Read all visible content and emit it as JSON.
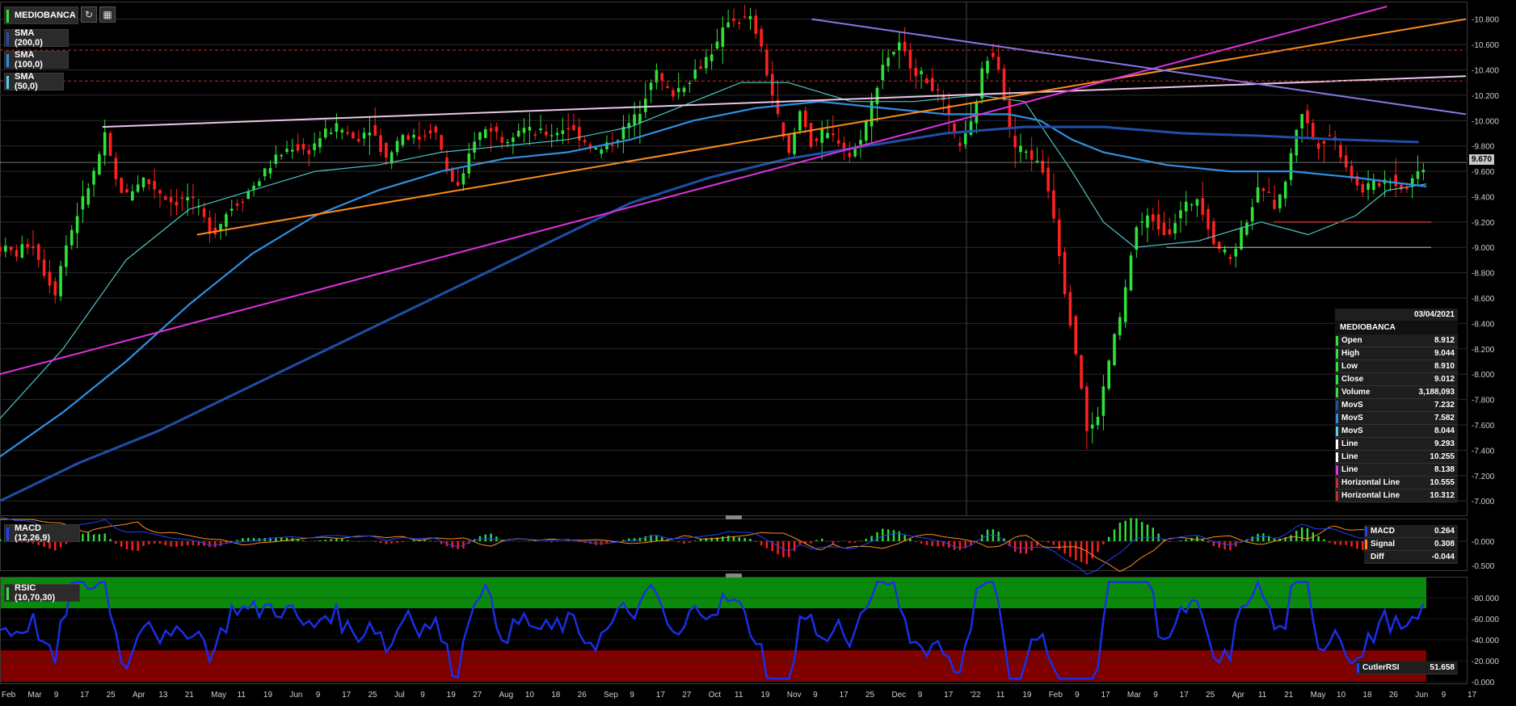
{
  "toolbar": {
    "symbol": "MEDIOBANCA",
    "refresh_icon": "refresh-icon",
    "calendar_icon": "calendar-icon"
  },
  "indicators": [
    {
      "label": "SMA (200,0)",
      "color": "#1f4fa8"
    },
    {
      "label": "SMA (100,0)",
      "color": "#2f8fe0"
    },
    {
      "label": "SMA (50,0)",
      "color": "#56d0e8"
    }
  ],
  "last_price": "9.670",
  "colors": {
    "bg": "#000000",
    "grid": "#2a2a2a",
    "up": "#2ee23a",
    "down": "#ff2020",
    "sma200": "#1f4fa8",
    "sma100": "#2f8fe0",
    "sma50": "#4cc6c6",
    "line_white": "#e8c8e8",
    "line_orange": "#ff8c1a",
    "line_magenta": "#e030e0",
    "line_lavender": "#8878e8",
    "hline": "#c03030",
    "macd": "#2040ff",
    "signal": "#ff8c1a",
    "rsi": "#1a2ee8",
    "rsi_high": "#0a8a0a",
    "rsi_low": "#800000"
  },
  "info_panel": {
    "date": "03/04/2021",
    "name": "MEDIOBANCA",
    "rows": [
      {
        "label": "Open",
        "value": "8.912",
        "color": "#2ee23a"
      },
      {
        "label": "High",
        "value": "9.044",
        "color": "#2ee23a"
      },
      {
        "label": "Low",
        "value": "8.910",
        "color": "#2ee23a"
      },
      {
        "label": "Close",
        "value": "9.012",
        "color": "#2ee23a"
      },
      {
        "label": "Volume",
        "value": "3,188,093",
        "color": "#2ee23a"
      },
      {
        "label": "MovS",
        "value": "7.232",
        "color": "#1f4fa8"
      },
      {
        "label": "MovS",
        "value": "7.582",
        "color": "#2f8fe0"
      },
      {
        "label": "MovS",
        "value": "8.044",
        "color": "#56d0e8"
      },
      {
        "label": "Line",
        "value": "9.293",
        "color": "#ffffff"
      },
      {
        "label": "Line",
        "value": "10.255",
        "color": "#ffffff"
      },
      {
        "label": "Line",
        "value": "8.138",
        "color": "#e030e0"
      },
      {
        "label": "Horizontal Line",
        "value": "10.555",
        "color": "#c03030"
      },
      {
        "label": "Horizontal Line",
        "value": "10.312",
        "color": "#c03030"
      }
    ]
  },
  "macd_panel": {
    "label": "MACD (12,26,9)",
    "rows": [
      {
        "label": "MACD",
        "value": "0.264",
        "color": "#2040ff"
      },
      {
        "label": "Signal",
        "value": "0.308",
        "color": "#ff8c1a"
      },
      {
        "label": "Diff",
        "value": "-0.044",
        "color": "#1e1e1e"
      }
    ],
    "ticks": [
      "-0.000",
      "-0.500"
    ]
  },
  "rsi_panel": {
    "label": "RSIC (10,70,30)",
    "row": {
      "label": "CutlerRSI",
      "value": "51.658",
      "color": "#2040ff"
    },
    "ticks": [
      "80.000",
      "60.000",
      "40.000",
      "20.000",
      "0.000"
    ]
  },
  "chart_data": {
    "type": "candlestick",
    "y_ticks": [
      "10.800",
      "10.600",
      "10.400",
      "10.200",
      "10.000",
      "9.800",
      "9.600",
      "9.400",
      "9.200",
      "9.000",
      "8.800",
      "8.600",
      "8.400",
      "8.200",
      "8.000",
      "7.800",
      "7.600",
      "7.400",
      "7.200",
      "7.000"
    ],
    "ylim": [
      6.95,
      10.9
    ],
    "x_ticks": [
      "Feb",
      "Mar",
      "9",
      "17",
      "25",
      "Apr",
      "13",
      "21",
      "May",
      "11",
      "19",
      "Jun",
      "9",
      "17",
      "25",
      "Jul",
      "9",
      "19",
      "27",
      "Aug",
      "10",
      "18",
      "26",
      "Sep",
      "9",
      "17",
      "27",
      "Oct",
      "11",
      "19",
      "Nov",
      "9",
      "17",
      "25",
      "Dec",
      "9",
      "17",
      "'22",
      "11",
      "19",
      "Feb",
      "9",
      "17",
      "Mar",
      "9",
      "17",
      "25",
      "Apr",
      "11",
      "21",
      "May",
      "10",
      "18",
      "26",
      "Jun",
      "9",
      "17"
    ],
    "close_path": [
      [
        0,
        9.0
      ],
      [
        10,
        8.95
      ],
      [
        20,
        9.05
      ],
      [
        30,
        8.75
      ],
      [
        35,
        8.65
      ],
      [
        40,
        8.95
      ],
      [
        50,
        9.3
      ],
      [
        60,
        9.6
      ],
      [
        67,
        9.9
      ],
      [
        72,
        9.55
      ],
      [
        80,
        9.4
      ],
      [
        90,
        9.55
      ],
      [
        100,
        9.45
      ],
      [
        110,
        9.35
      ],
      [
        120,
        9.4
      ],
      [
        128,
        9.25
      ],
      [
        135,
        9.1
      ],
      [
        145,
        9.3
      ],
      [
        155,
        9.4
      ],
      [
        165,
        9.55
      ],
      [
        175,
        9.7
      ],
      [
        185,
        9.8
      ],
      [
        195,
        9.75
      ],
      [
        205,
        9.9
      ],
      [
        215,
        9.95
      ],
      [
        225,
        9.85
      ],
      [
        235,
        9.95
      ],
      [
        245,
        9.7
      ],
      [
        255,
        9.9
      ],
      [
        265,
        9.85
      ],
      [
        275,
        9.95
      ],
      [
        285,
        9.55
      ],
      [
        292,
        9.45
      ],
      [
        300,
        9.85
      ],
      [
        310,
        9.95
      ],
      [
        320,
        9.85
      ],
      [
        330,
        9.95
      ],
      [
        340,
        9.9
      ],
      [
        350,
        9.9
      ],
      [
        360,
        9.95
      ],
      [
        370,
        9.85
      ],
      [
        380,
        9.75
      ],
      [
        390,
        9.85
      ],
      [
        397,
        9.95
      ],
      [
        405,
        10.05
      ],
      [
        415,
        10.4
      ],
      [
        425,
        10.2
      ],
      [
        435,
        10.3
      ],
      [
        445,
        10.45
      ],
      [
        455,
        10.6
      ],
      [
        462,
        10.8
      ],
      [
        470,
        10.8
      ],
      [
        477,
        10.8
      ],
      [
        482,
        10.6
      ],
      [
        490,
        10.2
      ],
      [
        500,
        9.7
      ],
      [
        508,
        10.1
      ],
      [
        515,
        9.8
      ],
      [
        522,
        9.9
      ],
      [
        532,
        9.85
      ],
      [
        540,
        9.7
      ],
      [
        550,
        10.0
      ],
      [
        560,
        10.45
      ],
      [
        570,
        10.6
      ],
      [
        580,
        10.4
      ],
      [
        590,
        10.3
      ],
      [
        600,
        10.1
      ],
      [
        607,
        9.8
      ],
      [
        615,
        9.9
      ],
      [
        625,
        10.5
      ],
      [
        632,
        10.55
      ],
      [
        642,
        9.8
      ],
      [
        652,
        9.75
      ],
      [
        662,
        9.6
      ],
      [
        668,
        9.3
      ],
      [
        675,
        8.7
      ],
      [
        685,
        8.0
      ],
      [
        690,
        7.5
      ],
      [
        697,
        7.7
      ],
      [
        705,
        8.2
      ],
      [
        712,
        8.5
      ],
      [
        720,
        9.15
      ],
      [
        730,
        9.25
      ],
      [
        740,
        9.1
      ],
      [
        750,
        9.3
      ],
      [
        760,
        9.4
      ],
      [
        770,
        9.05
      ],
      [
        780,
        8.9
      ],
      [
        790,
        9.2
      ],
      [
        800,
        9.5
      ],
      [
        810,
        9.3
      ],
      [
        817,
        9.6
      ],
      [
        825,
        10.1
      ],
      [
        835,
        9.8
      ],
      [
        845,
        9.9
      ],
      [
        852,
        9.7
      ],
      [
        862,
        9.45
      ],
      [
        872,
        9.5
      ],
      [
        882,
        9.55
      ],
      [
        890,
        9.45
      ],
      [
        900,
        9.6
      ],
      [
        905,
        9.67
      ]
    ],
    "sma50": [
      [
        0,
        7.65
      ],
      [
        40,
        8.2
      ],
      [
        80,
        8.9
      ],
      [
        120,
        9.3
      ],
      [
        160,
        9.45
      ],
      [
        200,
        9.6
      ],
      [
        240,
        9.65
      ],
      [
        280,
        9.75
      ],
      [
        320,
        9.8
      ],
      [
        360,
        9.85
      ],
      [
        400,
        9.95
      ],
      [
        440,
        10.15
      ],
      [
        470,
        10.3
      ],
      [
        500,
        10.3
      ],
      [
        540,
        10.15
      ],
      [
        580,
        10.15
      ],
      [
        620,
        10.2
      ],
      [
        650,
        10.15
      ],
      [
        680,
        9.6
      ],
      [
        700,
        9.2
      ],
      [
        720,
        9.0
      ],
      [
        760,
        9.05
      ],
      [
        800,
        9.2
      ],
      [
        830,
        9.1
      ],
      [
        860,
        9.25
      ],
      [
        880,
        9.45
      ],
      [
        905,
        9.5
      ]
    ],
    "sma100": [
      [
        0,
        7.35
      ],
      [
        40,
        7.7
      ],
      [
        80,
        8.1
      ],
      [
        120,
        8.55
      ],
      [
        160,
        8.95
      ],
      [
        200,
        9.25
      ],
      [
        240,
        9.45
      ],
      [
        280,
        9.6
      ],
      [
        320,
        9.7
      ],
      [
        360,
        9.75
      ],
      [
        400,
        9.85
      ],
      [
        440,
        10.0
      ],
      [
        480,
        10.1
      ],
      [
        520,
        10.15
      ],
      [
        560,
        10.1
      ],
      [
        600,
        10.05
      ],
      [
        640,
        10.05
      ],
      [
        660,
        10.0
      ],
      [
        680,
        9.85
      ],
      [
        700,
        9.75
      ],
      [
        740,
        9.65
      ],
      [
        780,
        9.6
      ],
      [
        820,
        9.6
      ],
      [
        860,
        9.55
      ],
      [
        905,
        9.48
      ]
    ],
    "sma200": [
      [
        0,
        7.0
      ],
      [
        50,
        7.3
      ],
      [
        100,
        7.55
      ],
      [
        150,
        7.85
      ],
      [
        200,
        8.15
      ],
      [
        250,
        8.45
      ],
      [
        300,
        8.75
      ],
      [
        350,
        9.05
      ],
      [
        400,
        9.35
      ],
      [
        450,
        9.55
      ],
      [
        500,
        9.7
      ],
      [
        550,
        9.8
      ],
      [
        600,
        9.9
      ],
      [
        650,
        9.95
      ],
      [
        700,
        9.95
      ],
      [
        750,
        9.9
      ],
      [
        800,
        9.88
      ],
      [
        850,
        9.85
      ],
      [
        900,
        9.83
      ]
    ],
    "trend_white": [
      [
        65,
        9.95
      ],
      [
        930,
        10.35
      ]
    ],
    "trend_orange": [
      [
        125,
        9.1
      ],
      [
        930,
        10.8
      ]
    ],
    "trend_magenta": [
      [
        0,
        8.0
      ],
      [
        880,
        10.9
      ]
    ],
    "trend_lavender": [
      [
        515,
        10.8
      ],
      [
        930,
        10.05
      ]
    ],
    "hline_red_1": {
      "y": 10.555,
      "x0": 0,
      "x1": 930
    },
    "hline_red_2": {
      "y": 10.312,
      "x0": 0,
      "x1": 930
    },
    "hline_small": {
      "y": 9.2,
      "x0": 808,
      "x1": 908
    },
    "hline_white_small": {
      "y": 9.0,
      "x0": 740,
      "x1": 908
    }
  }
}
